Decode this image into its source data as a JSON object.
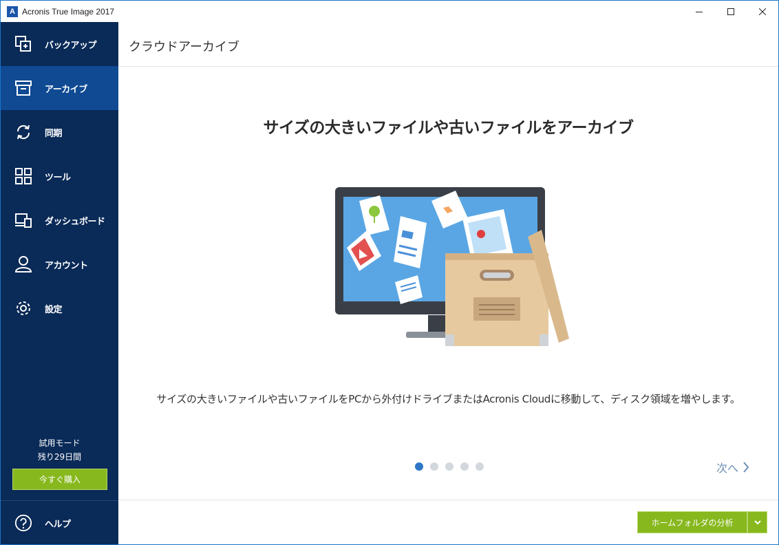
{
  "window": {
    "app_logo_letter": "A",
    "title": "Acronis True Image 2017"
  },
  "sidebar": {
    "items": [
      {
        "label": "バックアップ",
        "icon": "backup-icon"
      },
      {
        "label": "アーカイブ",
        "icon": "archive-icon",
        "active": true
      },
      {
        "label": "同期",
        "icon": "sync-icon"
      },
      {
        "label": "ツール",
        "icon": "tools-grid-icon"
      },
      {
        "label": "ダッシュボード",
        "icon": "dashboard-icon"
      },
      {
        "label": "アカウント",
        "icon": "account-icon"
      },
      {
        "label": "設定",
        "icon": "gear-icon"
      }
    ],
    "trial_mode": "試用モード",
    "trial_remaining": "残り29日間",
    "buy_now": "今すぐ購入",
    "help": "ヘルプ"
  },
  "main": {
    "page_title": "クラウドアーカイブ",
    "headline": "サイズの大きいファイルや古いファイルをアーカイブ",
    "description": "サイズの大きいファイルや古いファイルをPCから外付けドライブまたはAcronis Cloudに移動して、ディスク領域を増やします。",
    "carousel": {
      "total": 5,
      "active_index": 0
    },
    "next": "次へ",
    "analyze_button": "ホームフォルダの分析"
  },
  "colors": {
    "sidebar_bg": "#0a2a57",
    "sidebar_active": "#0f4a93",
    "accent_green": "#87b81e",
    "dot_active": "#2f77c8"
  }
}
